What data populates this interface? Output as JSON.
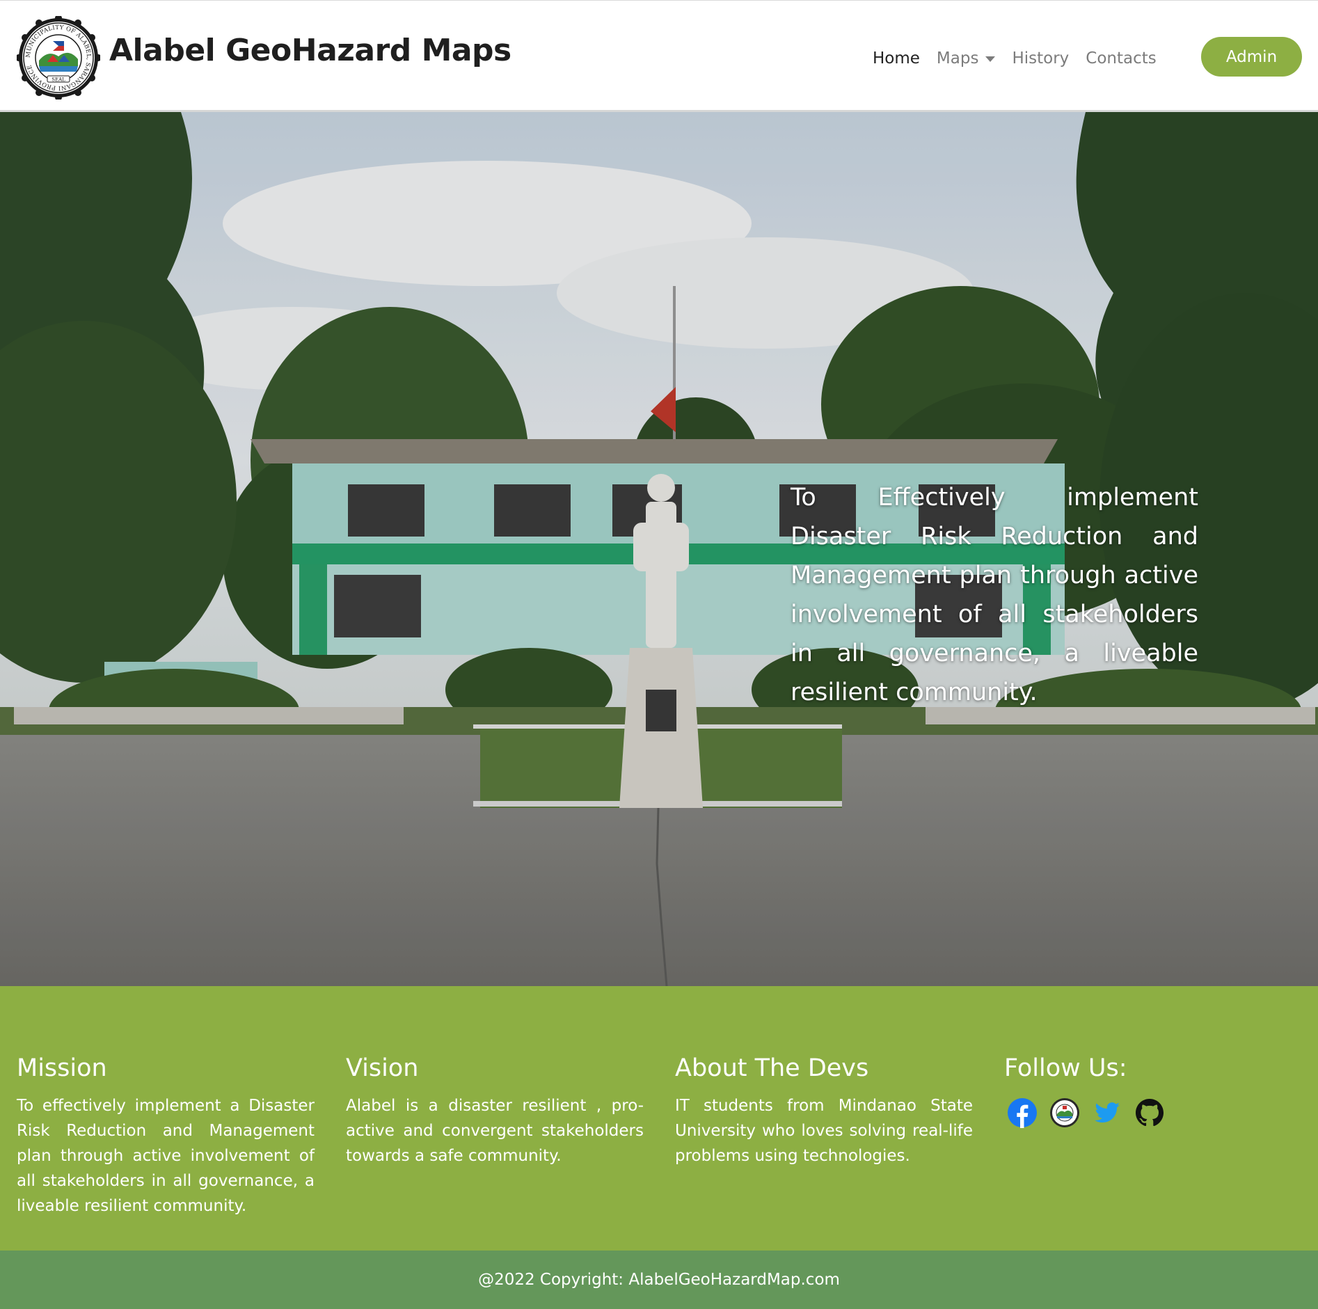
{
  "navbar": {
    "brand_title": "Alabel GeoHazard Maps",
    "seal_text": "MUNICIPALITY OF ALABEL, SARANGANI PROVINCE",
    "seal_label": "SEAL",
    "links": [
      {
        "label": "Home",
        "active": true
      },
      {
        "label": "Maps",
        "has_dropdown": true
      },
      {
        "label": "History"
      },
      {
        "label": "Contacts"
      }
    ],
    "admin_label": "Admin"
  },
  "hero": {
    "statement": "To Effectively implement Disaster Risk Reduction and Management plan through active involvement of all stakeholders in all governance, a liveable resilient community.",
    "image": "municipal-hall-with-statue-photo"
  },
  "info": {
    "mission": {
      "title": "Mission",
      "text": "To effectively implement a Disaster Risk Reduction and Management plan through active involvement of all stakeholders in all governance, a liveable resilient community."
    },
    "vision": {
      "title": "Vision",
      "text": "Alabel is a disaster resilient , pro-active and convergent stakeholders towards a safe community."
    },
    "about": {
      "title": "About The Devs",
      "text": "IT students from Mindanao State University who loves solving real-life problems using technologies."
    },
    "follow": {
      "title": "Follow Us:",
      "icons": [
        "facebook-icon",
        "municipal-seal-icon",
        "twitter-icon",
        "github-icon"
      ]
    }
  },
  "footer": {
    "copyright": "@2022 Copyright: AlabelGeoHazardMap.com"
  },
  "colors": {
    "accent_green": "#8daf43",
    "footer_green": "#64975a",
    "facebook_blue": "#1877f2",
    "twitter_blue": "#1d9bf0"
  }
}
